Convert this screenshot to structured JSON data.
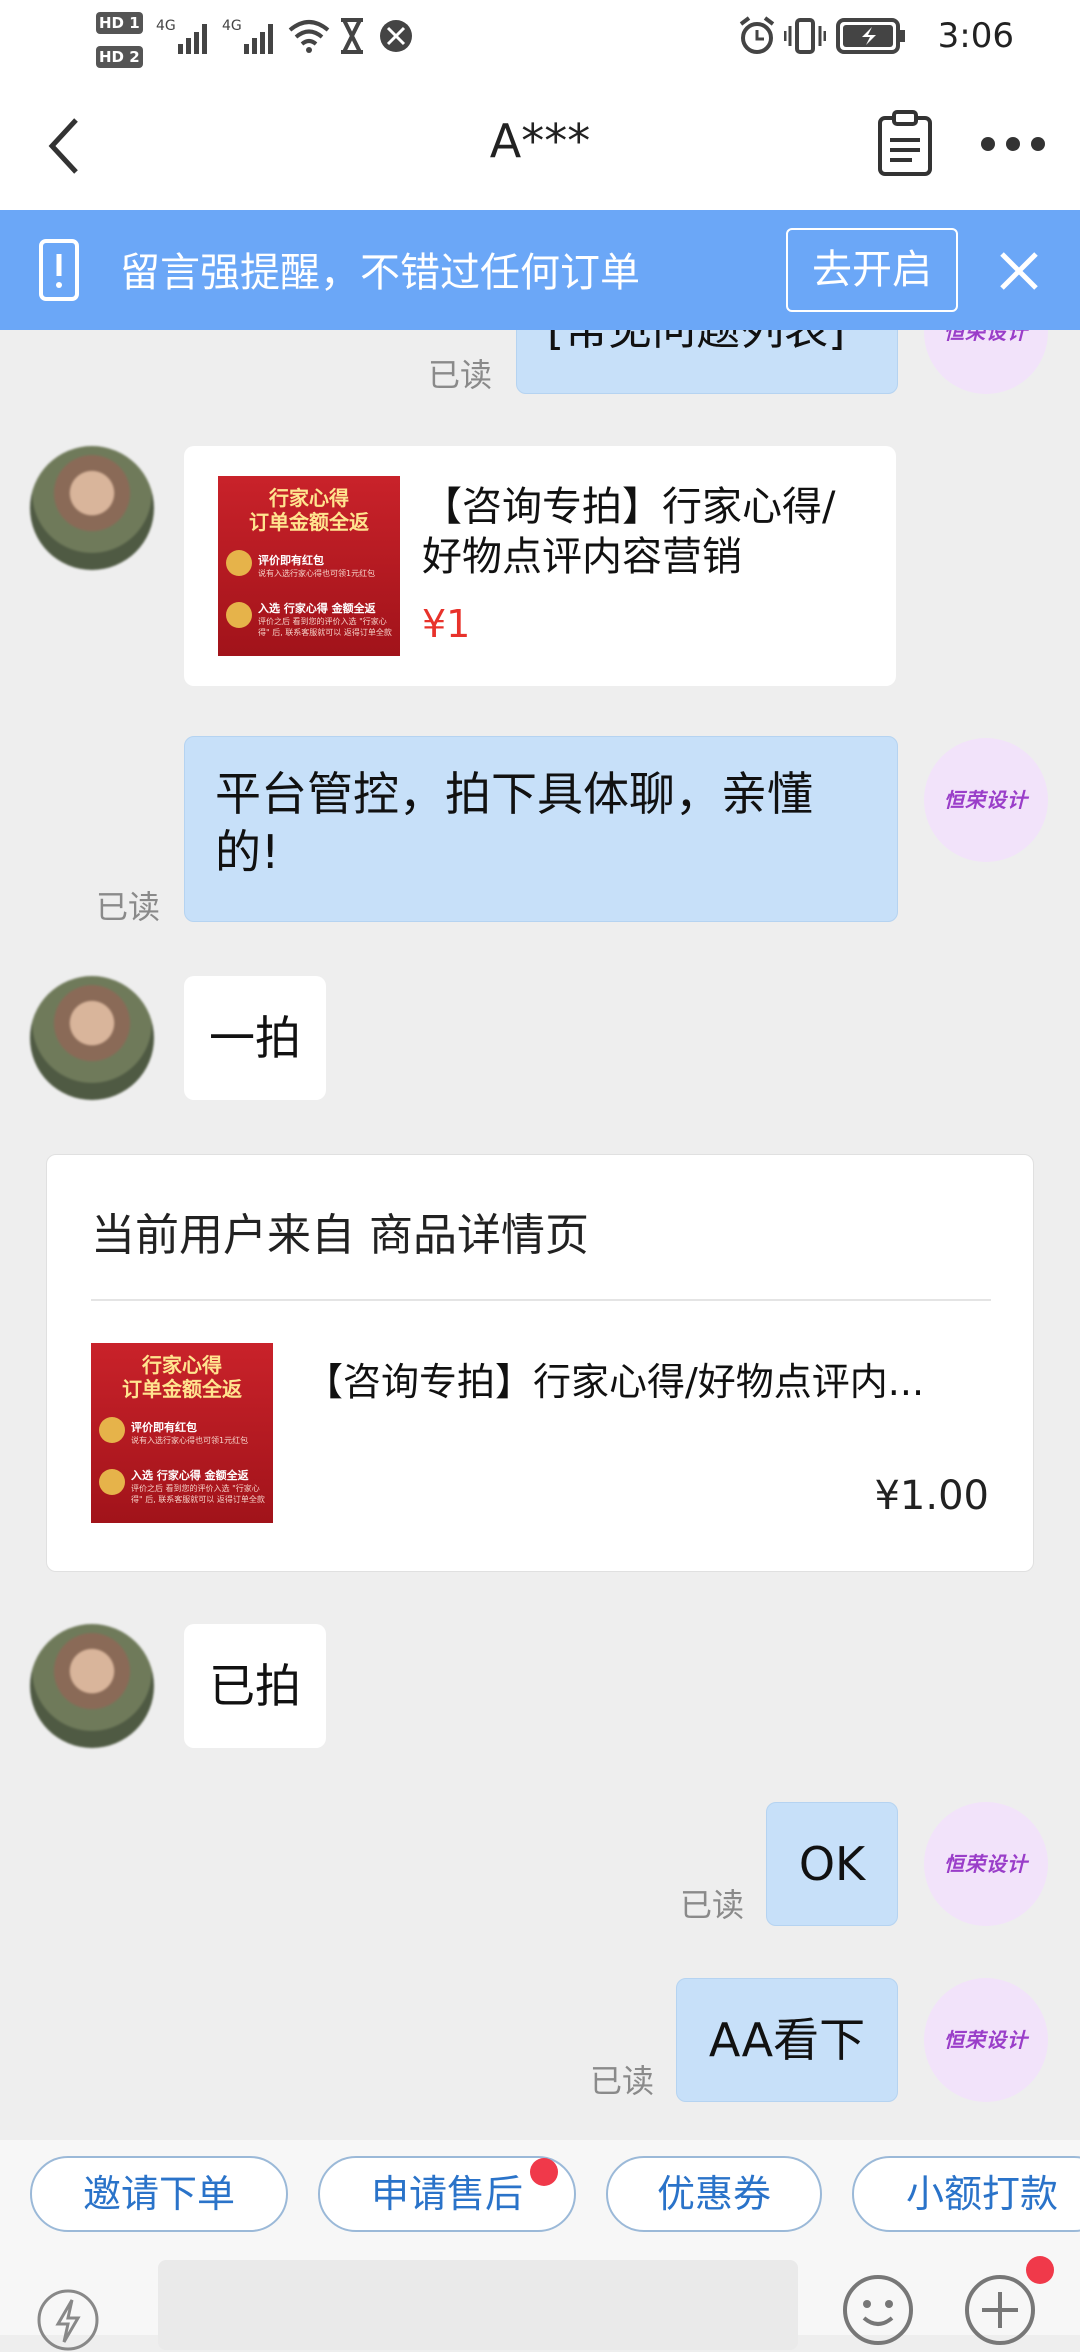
{
  "status_bar": {
    "sim1": "HD 1",
    "sim2": "HD 2",
    "net1": "4G",
    "net2": "4G",
    "time": "3:06"
  },
  "header": {
    "title": "A***",
    "back_icon": "chevron-left-icon",
    "notes_icon": "clipboard-icon",
    "more_icon": "more-dots-icon"
  },
  "banner": {
    "text": "留言强提醒，不错过任何订单",
    "button": "去开启",
    "close_icon": "close-icon"
  },
  "shop_avatar_text": "恒荣设计",
  "messages": {
    "m0": {
      "text": "[常见问题列表]",
      "read": "已读"
    },
    "m1": {
      "title": "【咨询专拍】行家心得/好物点评内容营销",
      "price": "¥1",
      "image": {
        "line1": "行家心得",
        "line2": "订单金额全返",
        "b1": "评价即有红包",
        "b1s": "说有入选行家心得也可领1元红包",
        "b2": "入选 行家心得 金额全返",
        "b2s": "评价之后 看到您的评价入选 \"行家心得\" 后, 联系客服就可以 返得订单全款"
      }
    },
    "m2": {
      "text": "平台管控，拍下具体聊，亲懂的!",
      "read": "已读"
    },
    "m3": {
      "text": "一拍"
    },
    "card": {
      "source": "当前用户来自 商品详情页",
      "title": "【咨询专拍】行家心得/好物点评内...",
      "price": "¥1.00"
    },
    "m4": {
      "text": "已拍"
    },
    "m5": {
      "text": "OK",
      "read": "已读"
    },
    "m6": {
      "text": "AA看下",
      "read": "已读"
    }
  },
  "quick_actions": [
    "邀请下单",
    "申请售后",
    "优惠券",
    "小额打款"
  ],
  "input_bar": {
    "left_icon": "lightning-icon",
    "emoji_icon": "smiley-icon",
    "plus_icon": "plus-icon"
  },
  "colors": {
    "banner_bg": "#6ba7f7",
    "bubble_out": "#c7e0f9",
    "chip_text": "#2a73c9",
    "price_red": "#e8322b",
    "badge_red": "#f0394a"
  }
}
